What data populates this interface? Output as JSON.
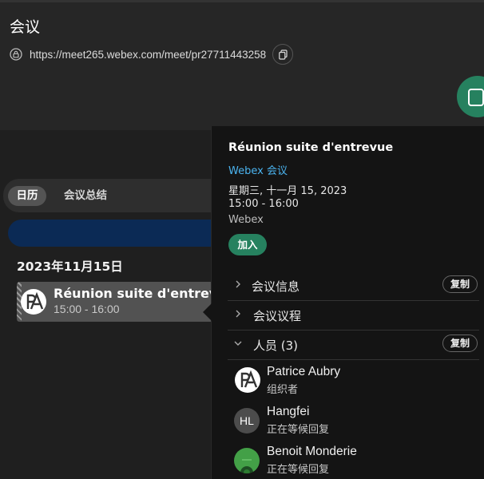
{
  "header": {
    "title": "会议",
    "url": "https://meet265.webex.com/meet/pr27711443258"
  },
  "tabs": {
    "calendar": "日历",
    "summary": "会议总结"
  },
  "calendar": {
    "date": "2023年11月15日",
    "event": {
      "title": "Réunion suite d'entrevue",
      "time": "15:00 - 16:00"
    }
  },
  "panel": {
    "title": "Réunion suite d'entrevue",
    "link": "Webex 会议",
    "date": "星期三, 十一月 15, 2023",
    "time": "15:00 - 16:00",
    "source": "Webex",
    "join": "加入",
    "sections": {
      "info": "会议信息",
      "agenda": "会议议程",
      "people": "人员 (3)",
      "copy": "复制"
    },
    "people": [
      {
        "name": "Patrice Aubry",
        "role": "组织者"
      },
      {
        "name": "Hangfei",
        "role": "正在等候回复",
        "initials": "HL"
      },
      {
        "name": "Benoit Monderie",
        "role": "正在等候回复"
      }
    ]
  },
  "colors": {
    "accent_green": "#26815f",
    "link_blue": "#4bb4f0",
    "banner_blue": "#0b2a55"
  }
}
